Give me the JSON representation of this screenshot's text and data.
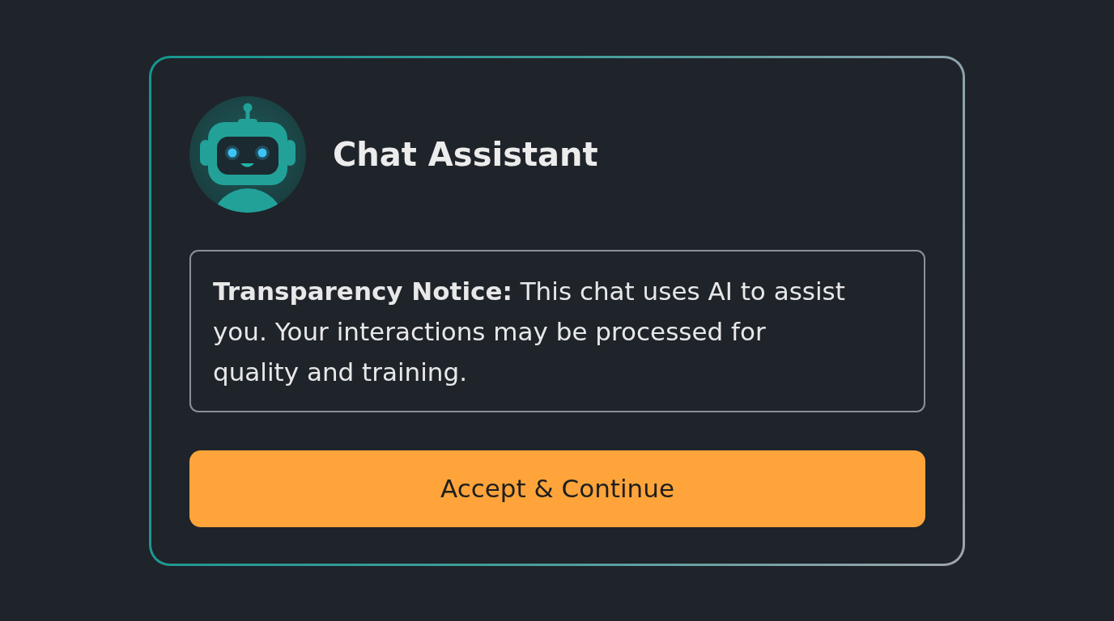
{
  "card": {
    "title": "Chat Assistant",
    "notice": "**Transparency Notice:** This chat uses AI to assist you. Your interactions may be processed for quality and training.",
    "button": "Accept & Continue"
  }
}
